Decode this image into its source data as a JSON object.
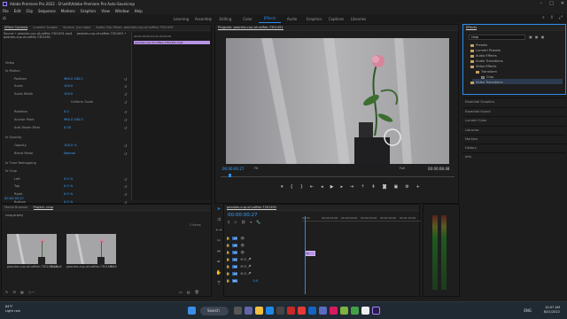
{
  "window": {
    "title": "Adobe Premiere Pro 2022 - D:\\edit\\Adobe Premiere Pro Auto-Save\\crop"
  },
  "menu": [
    "File",
    "Edit",
    "Clip",
    "Sequence",
    "Markers",
    "Graphics",
    "View",
    "Window",
    "Help"
  ],
  "workspaces": {
    "tabs": [
      "Learning",
      "Assembly",
      "Editing",
      "Color",
      "Effects",
      "Audio",
      "Graphics",
      "Captions",
      "Libraries"
    ],
    "active": "Effects"
  },
  "effect_controls": {
    "tabs": [
      "Effect Controls",
      "Lumetri Scopes",
      "Source: (no clips)",
      "Audio Clip Mixer: peonies-cup-of-coffee-7301491"
    ],
    "source": "Source • peonies-cup-of-coffee-7301491.mp4",
    "sequence": "peonies-cup-of-coffee-7301491 • peonies-cup-of-coffee-7301491",
    "mini_head": "00:00  00:00:04:00  00:00:05",
    "mini_clip": "peonies-cup-of-coffee-7301491.mp4",
    "rows": [
      {
        "label": "Video",
        "value": ""
      },
      {
        "label": "fx Motion",
        "value": ""
      },
      {
        "label": "Position",
        "value": "960.0   540.0"
      },
      {
        "label": "Scale",
        "value": "100.0"
      },
      {
        "label": "Scale Width",
        "value": "100.0"
      },
      {
        "label": "",
        "value": "Uniform Scale"
      },
      {
        "label": "Rotation",
        "value": "0.0"
      },
      {
        "label": "Anchor Point",
        "value": "960.0   540.0"
      },
      {
        "label": "Anti-flicker Filter",
        "value": "0.00"
      },
      {
        "label": "fx Opacity",
        "value": ""
      },
      {
        "label": "Opacity",
        "value": "100.0 %"
      },
      {
        "label": "Blend Mode",
        "value": "Normal"
      },
      {
        "label": "fx Time Remapping",
        "value": ""
      },
      {
        "label": "fx Crop",
        "value": ""
      },
      {
        "label": "Left",
        "value": "0.0 %"
      },
      {
        "label": "Top",
        "value": "0.0 %"
      },
      {
        "label": "Right",
        "value": "0.0 %"
      },
      {
        "label": "Bottom",
        "value": "0.0 %"
      },
      {
        "label": "",
        "value": "Zoom"
      },
      {
        "label": "Edge Feather",
        "value": "0"
      }
    ],
    "timecode": "00:00:00:27"
  },
  "program": {
    "title": "Program: peonies-cup-of-coffee-7301491",
    "timecode": "00:00:00:27",
    "fit": "Fit",
    "quality": "Full",
    "duration": "00:00:08:48"
  },
  "effects_panel": {
    "title": "Effects",
    "search": "crop",
    "tree": [
      {
        "label": "Presets",
        "kind": "folder"
      },
      {
        "label": "Lumetri Presets",
        "kind": "folder"
      },
      {
        "label": "Audio Effects",
        "kind": "folder"
      },
      {
        "label": "Audio Transitions",
        "kind": "folder"
      },
      {
        "label": "Video Effects",
        "kind": "folder"
      },
      {
        "label": "Transform",
        "kind": "folder"
      },
      {
        "label": "Crop",
        "kind": "fx"
      },
      {
        "label": "Video Transitions",
        "kind": "folder"
      }
    ]
  },
  "right_panels": [
    "Essential Graphics",
    "Essential Sound",
    "Lumetri Color",
    "Libraries",
    "Markers",
    "History",
    "Info"
  ],
  "project": {
    "tabs": [
      "Media Browser",
      "Project: crop"
    ],
    "name": "crop.prproj",
    "count": "2 items",
    "items": [
      {
        "name": "peonies-cup-of-coffee-7301491.mp4",
        "duration": "8:48"
      },
      {
        "name": "peonies-cup-of-coffee-7301491",
        "duration": "8:48"
      }
    ]
  },
  "timeline": {
    "tab": "peonies-cup-of-coffee-7301491",
    "timecode": "00:00:00:27",
    "ruler": [
      "00:00",
      "00:00:15:00",
      "00:00:30:00",
      "00:00:45:00",
      "00:01:00:00",
      "00:01:15:00"
    ],
    "tracks": [
      "V3",
      "V2",
      "V1",
      "A1",
      "A2",
      "A3",
      "Mix"
    ],
    "mix_value": "0.0",
    "clip_label": "fx"
  },
  "taskbar": {
    "weather_temp": "84°F",
    "weather_desc": "Light rain",
    "search": "Search",
    "time": "10:07 AM",
    "date": "8/31/2022",
    "lang": "ENG"
  }
}
